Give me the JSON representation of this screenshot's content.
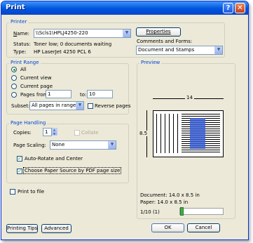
{
  "window": {
    "title": "Print",
    "help_glyph": "?",
    "close_glyph": "✕"
  },
  "printer": {
    "legend": "Printer",
    "name_label": "Name:",
    "name_value": "\\\\Scls1\\HPLJ4250-220",
    "properties_label": "Properties",
    "status_label": "Status:",
    "status_value": "Toner low; 0 documents waiting",
    "type_label": "Type:",
    "type_value": "HP LaserJet 4250 PCL 6",
    "comments_label": "Comments and Forms:",
    "comments_value": "Document and Stamps"
  },
  "print_range": {
    "legend": "Print Range",
    "all_label": "All",
    "current_view_label": "Current view",
    "current_page_label": "Current page",
    "pages_label": "Pages",
    "from_label": "from:",
    "from_value": "1",
    "to_label": "to:",
    "to_value": "10",
    "subset_label": "Subset:",
    "subset_value": "All pages in range",
    "reverse_label": "Reverse pages",
    "selected": "all"
  },
  "page_handling": {
    "legend": "Page Handling",
    "copies_label": "Copies:",
    "copies_value": "1",
    "collate_label": "Collate",
    "scaling_label": "Page Scaling:",
    "scaling_value": "None",
    "auto_rotate_label": "Auto-Rotate and Center",
    "auto_rotate_checked": true,
    "paper_source_label": "Choose Paper Source by PDF page size",
    "paper_source_checked": true
  },
  "print_to_file_label": "Print to file",
  "preview": {
    "legend": "Preview",
    "width_label": "14",
    "height_label": "8.5",
    "document_size": "Document: 14.0 x 8.5 in",
    "paper_size": "Paper: 14.0 x 8.5 in",
    "page_counter": "1/10 (1)",
    "slider_position": 0.0
  },
  "buttons": {
    "printing_tips": "Printing Tips",
    "advanced": "Advanced",
    "ok": "OK",
    "cancel": "Cancel"
  },
  "colors": {
    "title_bar": "#0054e3",
    "legend_text": "#0046d5",
    "dialog_bg": "#ece9d8",
    "check_mark": "#21a121"
  }
}
